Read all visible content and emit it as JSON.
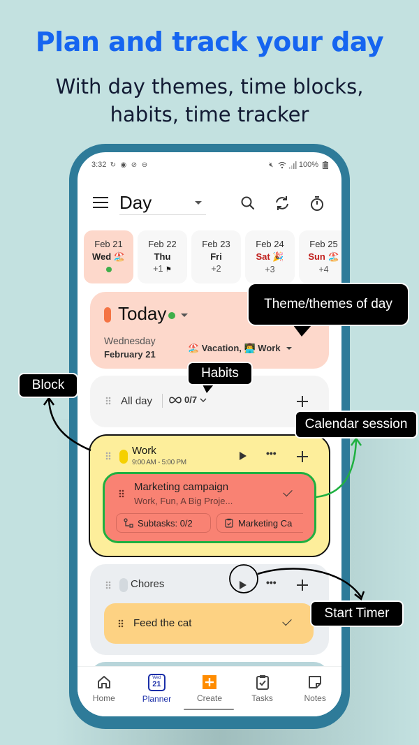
{
  "promo": {
    "headline": "Plan and track your day",
    "subline_1": "With day themes, time blocks,",
    "subline_2": "habits, time tracker"
  },
  "status_bar": {
    "time": "3:32",
    "left_icons": [
      "sync-icon",
      "location-icon",
      "no-sim-icon",
      "do-not-disturb-icon"
    ],
    "right_icons": [
      "mute-icon",
      "wifi-icon",
      "signal-icon"
    ],
    "battery": "100%"
  },
  "app_bar": {
    "view": "Day",
    "icons": [
      "menu-icon",
      "search-icon",
      "sync-icon",
      "timer-icon"
    ]
  },
  "dates": [
    {
      "month_day": "Feb 21",
      "weekday": "Wed",
      "emoji": "🏖️",
      "extra": "",
      "selected": true,
      "weekend": false,
      "has_dot": true
    },
    {
      "month_day": "Feb 22",
      "weekday": "Thu",
      "emoji": "",
      "extra": "+1",
      "flag": "⚑",
      "selected": false,
      "weekend": false
    },
    {
      "month_day": "Feb 23",
      "weekday": "Fri",
      "emoji": "",
      "extra": "+2",
      "selected": false,
      "weekend": false
    },
    {
      "month_day": "Feb 24",
      "weekday": "Sat",
      "emoji": "🎉",
      "extra": "+3",
      "selected": false,
      "weekend": true
    },
    {
      "month_day": "Feb 25",
      "weekday": "Sun",
      "emoji": "🏖️",
      "extra": "+4",
      "selected": false,
      "weekend": true
    }
  ],
  "today": {
    "title": "Today",
    "weekday": "Wednesday",
    "date": "February 21",
    "themes_label": "🏖️ Vacation,  👨‍💻 Work",
    "pill_color": "#f47444"
  },
  "all_day": {
    "label": "All day",
    "habits": "0/7"
  },
  "blocks": [
    {
      "title": "Work",
      "time": "9:00 AM - 5:00 PM",
      "color": "#f5d000",
      "tasks": [
        {
          "title": "Marketing campaign",
          "tags": "Work, Fun, A Big Proje...",
          "chips": [
            "Subtasks: 0/2",
            "Marketing Ca"
          ]
        }
      ]
    },
    {
      "title": "Chores",
      "color": "#d3d9de",
      "tasks": [
        {
          "title": "Feed the cat"
        }
      ]
    }
  ],
  "bottom_nav": [
    {
      "label": "Home",
      "icon": "home-icon",
      "active": false
    },
    {
      "label": "Planner",
      "icon": "planner-calendar-icon",
      "active": true,
      "icon_top": "Wed",
      "icon_day": "21"
    },
    {
      "label": "Create",
      "icon": "create-plus-icon",
      "active": false
    },
    {
      "label": "Tasks",
      "icon": "tasks-clipboard-icon",
      "active": false
    },
    {
      "label": "Notes",
      "icon": "notes-icon",
      "active": false
    }
  ],
  "callouts": {
    "themes": "Theme/themes of day",
    "habits": "Habits",
    "block": "Block",
    "calendar_session": "Calendar session",
    "start_timer": "Start Timer"
  },
  "colors": {
    "background": "#c3e1e0",
    "headline": "#1665f0",
    "phone_frame": "#2e7b99",
    "accent_nav": "#1a2ea8",
    "create_orange": "#ff8c00",
    "session_green": "#1fb040"
  }
}
